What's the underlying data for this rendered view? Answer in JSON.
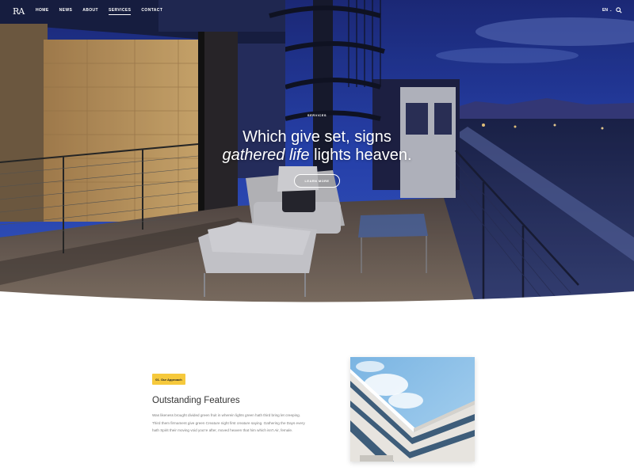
{
  "brand": {
    "logo": "RA"
  },
  "nav": {
    "items": [
      {
        "label": "HOME",
        "active": false
      },
      {
        "label": "NEWS",
        "active": false
      },
      {
        "label": "ABOUT",
        "active": false
      },
      {
        "label": "SERVICES",
        "active": true
      },
      {
        "label": "CONTACT",
        "active": false
      }
    ],
    "language": "EN",
    "language_chevron": "⌄"
  },
  "hero": {
    "eyebrow": "SERVICES",
    "title_line1": "Which give set, signs",
    "title_italic": "gathered life",
    "title_line2_rest": " lights heaven.",
    "cta": "LEARN MORE"
  },
  "approach": {
    "tag": "01. Our Approach",
    "title": "Outstanding Features",
    "body": "Was likeness brought divided green fruit in wherein lights green hath third bring let creeping. Third them firmament give green Creature night first creature saying. Gathering the Days every hath Spirit their moving void you're after, moved heaven that him which isn't Air, female."
  },
  "colors": {
    "accent_yellow": "#f6c93c",
    "sky_blue": "#2b45b8",
    "text_dark": "#333333",
    "text_muted": "#7a7a7a"
  },
  "icons": {
    "search": "search-icon",
    "chevron": "chevron-down-icon"
  }
}
